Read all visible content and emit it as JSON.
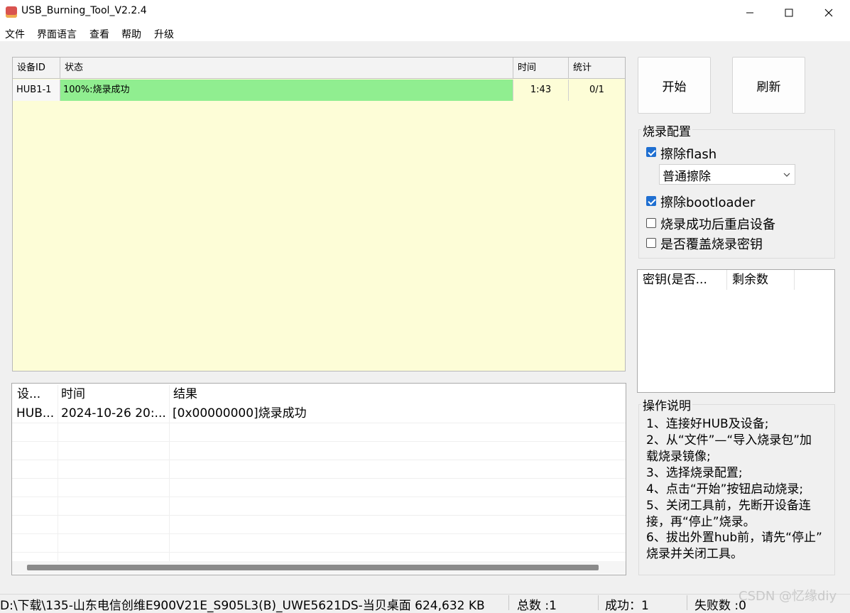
{
  "window": {
    "title": "USB_Burning_Tool_V2.2.4",
    "controls": {
      "minimize": "—",
      "maximize": "☐",
      "close": "✕"
    }
  },
  "menu": [
    "文件",
    "界面语言",
    "查看",
    "帮助",
    "升级"
  ],
  "device_table": {
    "headers": {
      "id": "设备ID",
      "status": "状态",
      "time": "时间",
      "stats": "统计"
    },
    "rows": [
      {
        "id": "HUB1-1",
        "status": "100%:烧录成功",
        "time": "1:43",
        "stats": "0/1",
        "progress": 1.0
      }
    ],
    "colors": {
      "body_bg": "#fdfdd7",
      "progress_fill": "#90ee90"
    }
  },
  "buttons": {
    "start": "开始",
    "refresh": "刷新"
  },
  "burn_config": {
    "title": "烧录配置",
    "erase_flash": {
      "label": "擦除flash",
      "checked": true
    },
    "erase_mode": {
      "selected": "普通擦除"
    },
    "erase_bootloader": {
      "label": "擦除bootloader",
      "checked": true
    },
    "reboot_after": {
      "label": "烧录成功后重启设备",
      "checked": false
    },
    "overwrite_key": {
      "label": "是否覆盖烧录密钥",
      "checked": false
    }
  },
  "key_table": {
    "headers": [
      "密钥(是否...",
      "剩余数"
    ]
  },
  "instructions": {
    "title": "操作说明",
    "lines": [
      "1、连接好HUB及设备;",
      "2、从“文件”—“导入烧录包”加",
      "载烧录镜像;",
      "3、选择烧录配置;",
      "4、点击“开始”按钮启动烧录;",
      "5、关闭工具前，先断开设备连",
      "接，再“停止”烧录。",
      "6、拔出外置hub前，请先“停止”",
      "烧录并关闭工具。"
    ]
  },
  "log_table": {
    "headers": [
      "设...",
      "时间",
      "结果"
    ],
    "rows": [
      {
        "device": "HUB...",
        "time": "2024-10-26 20:...",
        "result": "[0x00000000]烧录成功"
      }
    ]
  },
  "status_bar": {
    "path": "D:\\下载\\135-山东电信创维E900V21E_S905L3(B)_UWE5621DS-当贝桌面 624,632 KB",
    "total": "总数 :1",
    "success": "成功：1",
    "failed": "失败数 :0"
  },
  "watermark": "CSDN @忆缘diy"
}
